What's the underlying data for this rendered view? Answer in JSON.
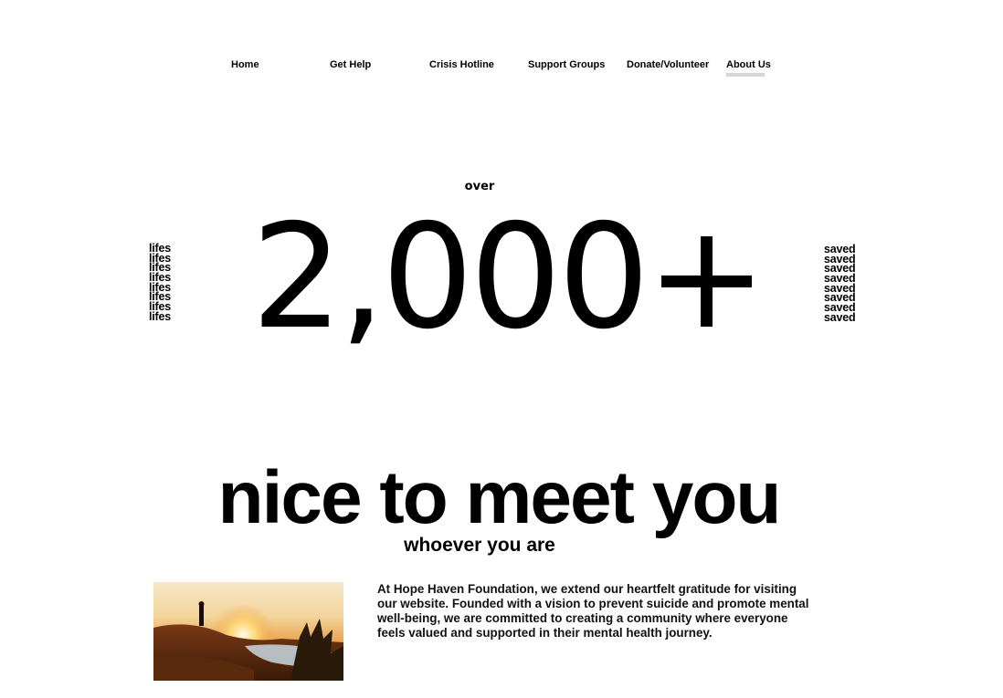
{
  "nav": {
    "items": [
      {
        "label": "Home"
      },
      {
        "label": "Get Help"
      },
      {
        "label": "Crisis Hotline"
      },
      {
        "label": "Support Groups"
      },
      {
        "label": "Donate/Volunteer"
      },
      {
        "label": "About Us",
        "active": true
      }
    ],
    "active_underline_color": "#d6d6d6"
  },
  "stat": {
    "prefix": "over",
    "number": "2,000+",
    "left_word": "lifes",
    "right_word": "saved",
    "repeat_count": 8
  },
  "hero": {
    "headline": "nice to meet you",
    "subheadline": "whoever you are"
  },
  "intro": {
    "text": "At Hope Haven Foundation, we extend our heartfelt gratitude for visiting our website. Founded with a vision to prevent suicide and promote mental well-being, we are committed to creating a community where everyone feels valued and supported in their mental health journey."
  },
  "photo": {
    "subject": "person standing on hillside at sunset",
    "accent_color": "#e8a040"
  }
}
